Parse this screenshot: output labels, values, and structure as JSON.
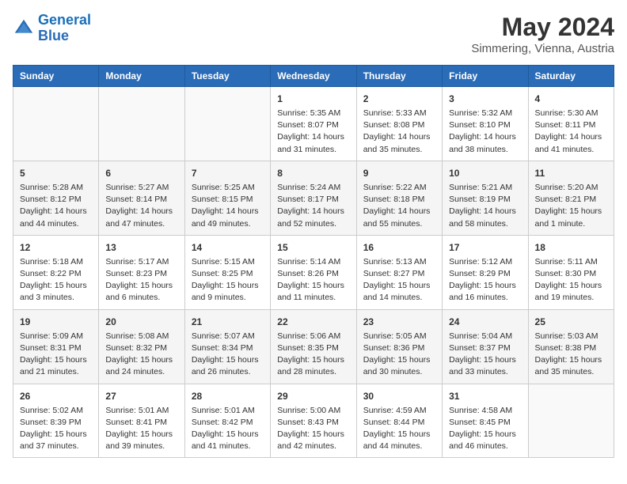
{
  "header": {
    "logo_line1": "General",
    "logo_line2": "Blue",
    "month": "May 2024",
    "location": "Simmering, Vienna, Austria"
  },
  "weekdays": [
    "Sunday",
    "Monday",
    "Tuesday",
    "Wednesday",
    "Thursday",
    "Friday",
    "Saturday"
  ],
  "weeks": [
    [
      {
        "day": "",
        "info": ""
      },
      {
        "day": "",
        "info": ""
      },
      {
        "day": "",
        "info": ""
      },
      {
        "day": "1",
        "info": "Sunrise: 5:35 AM\nSunset: 8:07 PM\nDaylight: 14 hours\nand 31 minutes."
      },
      {
        "day": "2",
        "info": "Sunrise: 5:33 AM\nSunset: 8:08 PM\nDaylight: 14 hours\nand 35 minutes."
      },
      {
        "day": "3",
        "info": "Sunrise: 5:32 AM\nSunset: 8:10 PM\nDaylight: 14 hours\nand 38 minutes."
      },
      {
        "day": "4",
        "info": "Sunrise: 5:30 AM\nSunset: 8:11 PM\nDaylight: 14 hours\nand 41 minutes."
      }
    ],
    [
      {
        "day": "5",
        "info": "Sunrise: 5:28 AM\nSunset: 8:12 PM\nDaylight: 14 hours\nand 44 minutes."
      },
      {
        "day": "6",
        "info": "Sunrise: 5:27 AM\nSunset: 8:14 PM\nDaylight: 14 hours\nand 47 minutes."
      },
      {
        "day": "7",
        "info": "Sunrise: 5:25 AM\nSunset: 8:15 PM\nDaylight: 14 hours\nand 49 minutes."
      },
      {
        "day": "8",
        "info": "Sunrise: 5:24 AM\nSunset: 8:17 PM\nDaylight: 14 hours\nand 52 minutes."
      },
      {
        "day": "9",
        "info": "Sunrise: 5:22 AM\nSunset: 8:18 PM\nDaylight: 14 hours\nand 55 minutes."
      },
      {
        "day": "10",
        "info": "Sunrise: 5:21 AM\nSunset: 8:19 PM\nDaylight: 14 hours\nand 58 minutes."
      },
      {
        "day": "11",
        "info": "Sunrise: 5:20 AM\nSunset: 8:21 PM\nDaylight: 15 hours\nand 1 minute."
      }
    ],
    [
      {
        "day": "12",
        "info": "Sunrise: 5:18 AM\nSunset: 8:22 PM\nDaylight: 15 hours\nand 3 minutes."
      },
      {
        "day": "13",
        "info": "Sunrise: 5:17 AM\nSunset: 8:23 PM\nDaylight: 15 hours\nand 6 minutes."
      },
      {
        "day": "14",
        "info": "Sunrise: 5:15 AM\nSunset: 8:25 PM\nDaylight: 15 hours\nand 9 minutes."
      },
      {
        "day": "15",
        "info": "Sunrise: 5:14 AM\nSunset: 8:26 PM\nDaylight: 15 hours\nand 11 minutes."
      },
      {
        "day": "16",
        "info": "Sunrise: 5:13 AM\nSunset: 8:27 PM\nDaylight: 15 hours\nand 14 minutes."
      },
      {
        "day": "17",
        "info": "Sunrise: 5:12 AM\nSunset: 8:29 PM\nDaylight: 15 hours\nand 16 minutes."
      },
      {
        "day": "18",
        "info": "Sunrise: 5:11 AM\nSunset: 8:30 PM\nDaylight: 15 hours\nand 19 minutes."
      }
    ],
    [
      {
        "day": "19",
        "info": "Sunrise: 5:09 AM\nSunset: 8:31 PM\nDaylight: 15 hours\nand 21 minutes."
      },
      {
        "day": "20",
        "info": "Sunrise: 5:08 AM\nSunset: 8:32 PM\nDaylight: 15 hours\nand 24 minutes."
      },
      {
        "day": "21",
        "info": "Sunrise: 5:07 AM\nSunset: 8:34 PM\nDaylight: 15 hours\nand 26 minutes."
      },
      {
        "day": "22",
        "info": "Sunrise: 5:06 AM\nSunset: 8:35 PM\nDaylight: 15 hours\nand 28 minutes."
      },
      {
        "day": "23",
        "info": "Sunrise: 5:05 AM\nSunset: 8:36 PM\nDaylight: 15 hours\nand 30 minutes."
      },
      {
        "day": "24",
        "info": "Sunrise: 5:04 AM\nSunset: 8:37 PM\nDaylight: 15 hours\nand 33 minutes."
      },
      {
        "day": "25",
        "info": "Sunrise: 5:03 AM\nSunset: 8:38 PM\nDaylight: 15 hours\nand 35 minutes."
      }
    ],
    [
      {
        "day": "26",
        "info": "Sunrise: 5:02 AM\nSunset: 8:39 PM\nDaylight: 15 hours\nand 37 minutes."
      },
      {
        "day": "27",
        "info": "Sunrise: 5:01 AM\nSunset: 8:41 PM\nDaylight: 15 hours\nand 39 minutes."
      },
      {
        "day": "28",
        "info": "Sunrise: 5:01 AM\nSunset: 8:42 PM\nDaylight: 15 hours\nand 41 minutes."
      },
      {
        "day": "29",
        "info": "Sunrise: 5:00 AM\nSunset: 8:43 PM\nDaylight: 15 hours\nand 42 minutes."
      },
      {
        "day": "30",
        "info": "Sunrise: 4:59 AM\nSunset: 8:44 PM\nDaylight: 15 hours\nand 44 minutes."
      },
      {
        "day": "31",
        "info": "Sunrise: 4:58 AM\nSunset: 8:45 PM\nDaylight: 15 hours\nand 46 minutes."
      },
      {
        "day": "",
        "info": ""
      }
    ]
  ]
}
